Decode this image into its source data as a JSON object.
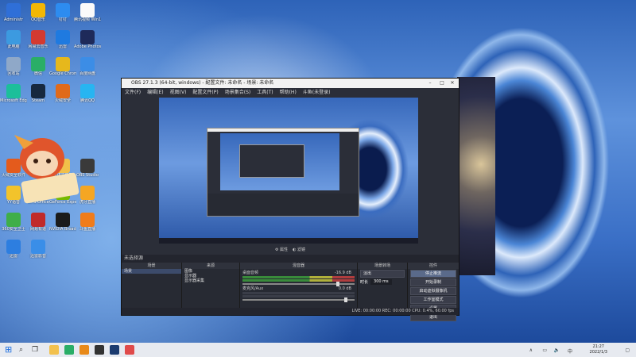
{
  "desktop_icons": [
    {
      "label": "Administr",
      "color": "#2f6fd8"
    },
    {
      "label": "QQ音乐",
      "color": "#f2b705"
    },
    {
      "label": "钉钉",
      "color": "#2d8cf0"
    },
    {
      "label": "腾讯视频 Win10版",
      "color": "#fafafa"
    },
    {
      "label": "此电脑",
      "color": "#3c9ae0"
    },
    {
      "label": "网易云音乐",
      "color": "#d33a31"
    },
    {
      "label": "迅雷",
      "color": "#1f7ae0"
    },
    {
      "label": "Adobe Photosh",
      "color": "#1e2a5a"
    },
    {
      "label": "回收站",
      "color": "#8fa8c8"
    },
    {
      "label": "微信",
      "color": "#2aae67"
    },
    {
      "label": "Google Chrome",
      "color": "#e6b81c"
    },
    {
      "label": "百度网盘",
      "color": "#3c8de6"
    },
    {
      "label": "Microsoft Edge",
      "color": "#1bbf9a"
    },
    {
      "label": "Steam",
      "color": "#17293f"
    },
    {
      "label": "火绒安全",
      "color": "#e06a1b"
    },
    {
      "label": "腾讯QQ",
      "color": "#27b5f1"
    },
    {
      "label": "火绒安全软件",
      "color": "#e45b1c"
    },
    {
      "label": "WeGame",
      "color": "#d43b2d"
    },
    {
      "label": "新建文件夹",
      "color": "#f1c04a"
    },
    {
      "label": "OBS Studio",
      "color": "#3a3a3a"
    },
    {
      "label": "YY语音",
      "color": "#f2c32b"
    },
    {
      "label": "WPS Office",
      "color": "#d9362c"
    },
    {
      "label": "GeForce Experience",
      "color": "#76b900"
    },
    {
      "label": "虎牙直播",
      "color": "#f5a623"
    },
    {
      "label": "360安全卫士",
      "color": "#3fae49"
    },
    {
      "label": "网易有道",
      "color": "#c02a2a"
    },
    {
      "label": "NVIDIA Broadcast",
      "color": "#1b1b1b"
    },
    {
      "label": "斗鱼直播",
      "color": "#f07c1a"
    },
    {
      "label": "迅雷",
      "color": "#2d7ee0"
    },
    {
      "label": "迅雷影音",
      "color": "#3a8ee8"
    }
  ],
  "obs": {
    "title": "OBS 27.1.3 (64-bit, windows) - 配置文件: 未命名 - 场景: 未命名",
    "menu": [
      "文件(F)",
      "编辑(E)",
      "视图(V)",
      "配置文件(P)",
      "场景集合(S)",
      "工具(T)",
      "帮助(H)",
      "斗鱼(未登录)"
    ],
    "toolbar": [
      "属性",
      "滤镜"
    ],
    "scene_bar": "未选择源",
    "docks": {
      "scenes": {
        "header": "场景",
        "items": [
          "场景"
        ]
      },
      "sources": {
        "header": "来源",
        "items": [
          "图像",
          "显示器",
          "显示器采集"
        ]
      },
      "mixer": {
        "header": "混音器",
        "tracks": [
          {
            "name": "桌面音频",
            "db": "-16.9 dB"
          },
          {
            "name": "麦克风/Aux",
            "db": "0.0 dB"
          }
        ]
      },
      "transitions": {
        "header": "场景转场",
        "type": "淡出",
        "duration_label": "时长",
        "duration": "300 ms"
      },
      "controls": {
        "header": "控件",
        "buttons": [
          "停止推流",
          "开始录制",
          "启动虚拟摄像机",
          "工作室模式",
          "设置",
          "退出"
        ]
      }
    },
    "status": "LIVE: 00:00:00   REC: 00:00:00   CPU: 0.4%, 60.00 fps"
  },
  "taskbar": {
    "time": "21:27",
    "date": "2022/1/3",
    "apps": [
      {
        "name": "file-explorer",
        "color": "#f2c14e"
      },
      {
        "name": "wechat",
        "color": "#2aae67"
      },
      {
        "name": "app-orange",
        "color": "#e88a1a"
      },
      {
        "name": "obs",
        "color": "#333333"
      },
      {
        "name": "steam",
        "color": "#1b3b6f"
      },
      {
        "name": "app-red",
        "color": "#e04b4b"
      }
    ]
  }
}
